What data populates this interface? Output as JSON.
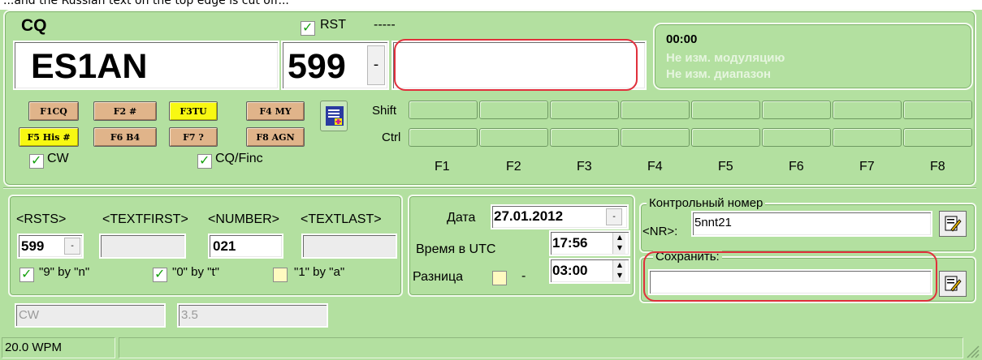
{
  "top_strip_text": "...and the Russian text on the top edge is cut off...",
  "header": {
    "callsign_label": "CQ",
    "rst_checkbox_label": "RST",
    "rst_dashes": "-----",
    "callsign_value": "ES1AN",
    "rst_value": "599",
    "dropdown_glyph": "-"
  },
  "info": {
    "time": "00:00",
    "line1": "Не изм. модуляцию",
    "line2": "Не изм. диапазон"
  },
  "fkeys": [
    {
      "label": "F1CQ",
      "color": "#e0b48a"
    },
    {
      "label": "F2 #",
      "color": "#e0b48a"
    },
    {
      "label": "F3TU",
      "color": "#f8f812"
    },
    {
      "label": "F4 MY",
      "color": "#e0b48a"
    },
    {
      "label": "F5 His #",
      "color": "#f8f812"
    },
    {
      "label": "F6 B4",
      "color": "#e0b48a"
    },
    {
      "label": "F7 ?",
      "color": "#e0b48a"
    },
    {
      "label": "F8 AGN",
      "color": "#e0b48a"
    }
  ],
  "macro_rows": {
    "shift": "Shift",
    "ctrl": "Ctrl"
  },
  "macro_labels": [
    "F1",
    "F2",
    "F3",
    "F4",
    "F5",
    "F6",
    "F7",
    "F8"
  ],
  "checks": {
    "cw": "CW",
    "cqfinc": "CQ/Finc"
  },
  "exchange": {
    "headers": [
      "<RSTS>",
      "<TEXTFIRST>",
      "<NUMBER>",
      "<TEXTLAST>"
    ],
    "rsts_value": "599",
    "number_value": "021",
    "opt9": "\"9\" by \"n\"",
    "opt0": "\"0\" by \"t\"",
    "opt1": "\"1\" by \"a\""
  },
  "datetime": {
    "date_label": "Дата",
    "date_value": "27.01.2012",
    "utc_label": "Время в UTC",
    "utc_value": "17:56",
    "diff_label": "Разница",
    "diff_sign": "-",
    "diff_value": "03:00"
  },
  "control": {
    "group_label": "Контрольный номер",
    "nr_label": "<NR>:",
    "nr_value": "5nnt21",
    "save_label": "Сохранить:",
    "save_value": ""
  },
  "mode": {
    "mode": "CW",
    "band": "3.5"
  },
  "status": {
    "wpm": "20.0 WPM"
  }
}
